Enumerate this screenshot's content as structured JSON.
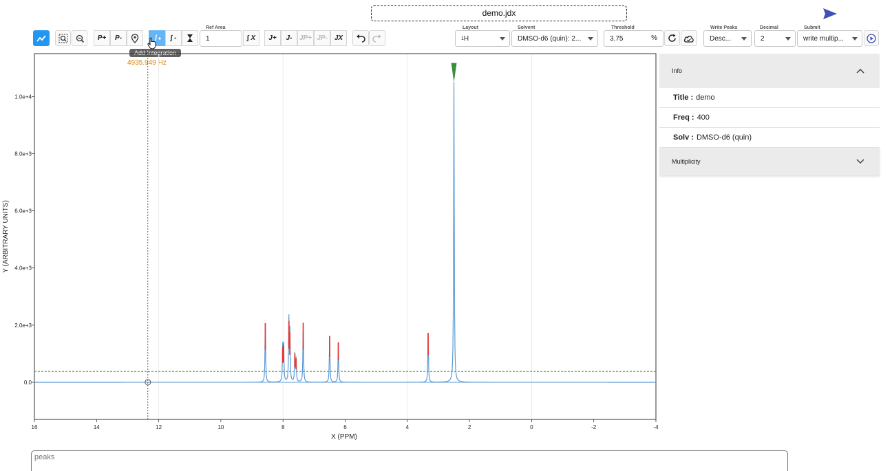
{
  "file": {
    "title": "demo.jdx"
  },
  "toolbar": {
    "peak_add": "P+",
    "peak_remove": "P-",
    "integration_remove": "∫ -",
    "ref_area_label": "Ref Area",
    "ref_area_value": "1",
    "integration_x": "∫ X",
    "j_add": "J+",
    "j_remove": "J-",
    "jp_add": "JP+",
    "jp_remove": "JP-",
    "jx": "JX",
    "layout_label": "Layout",
    "layout_prefix": "1",
    "layout_value": "H",
    "solvent_label": "Solvent",
    "solvent_value": "DMSO-d6 (quin): 2...",
    "threshold_label": "Threshold",
    "threshold_value": "3.75",
    "threshold_unit": "%",
    "write_peaks_label": "Write Peaks",
    "write_peaks_value": "Desc...",
    "decimal_label": "Decimal",
    "decimal_value": "2",
    "submit_label": "Submit",
    "submit_value": "write multip..."
  },
  "tooltip": {
    "text": "Add Integration"
  },
  "cursor": {
    "readout": "4935.949 Hz"
  },
  "chart_data": {
    "type": "line",
    "xlabel": "X (PPM)",
    "ylabel": "Y (ARBITRARY UNITS)",
    "xlim": [
      16,
      -4
    ],
    "ylim": [
      -1300,
      11500
    ],
    "x_ticks": [
      "16",
      "14",
      "12",
      "10",
      "8",
      "6",
      "4",
      "2",
      "0",
      "-2",
      "-4"
    ],
    "y_ticks": [
      "0.0",
      "2.0e+3",
      "4.0e+3",
      "6.0e+3",
      "8.0e+3",
      "1.0e+4"
    ],
    "threshold_y": 380,
    "cursor_x": 12.35,
    "peaks": [
      {
        "x": 8.57,
        "y": 2070
      },
      {
        "x": 8.01,
        "y": 1230
      },
      {
        "x": 7.98,
        "y": 1300
      },
      {
        "x": 7.81,
        "y": 2150
      },
      {
        "x": 7.78,
        "y": 1750
      },
      {
        "x": 7.62,
        "y": 1000
      },
      {
        "x": 7.58,
        "y": 830
      },
      {
        "x": 7.35,
        "y": 2080
      },
      {
        "x": 6.5,
        "y": 1620
      },
      {
        "x": 6.22,
        "y": 1400
      },
      {
        "x": 3.33,
        "y": 1730
      },
      {
        "x": 2.5,
        "y": 10500
      }
    ],
    "colors": {
      "line": "#5b9bd5",
      "peak": "#e53935",
      "threshold": "#43a047",
      "marker": "#388e3c"
    }
  },
  "info_panel": {
    "header": "Info",
    "rows": [
      {
        "label": "Title :",
        "value": "demo"
      },
      {
        "label": "Freq :",
        "value": "400"
      },
      {
        "label": "Solv :",
        "value": "DMSO-d6 (quin)"
      }
    ],
    "multiplicity": "Multiplicity"
  },
  "peaks_input": {
    "placeholder": "peaks"
  }
}
